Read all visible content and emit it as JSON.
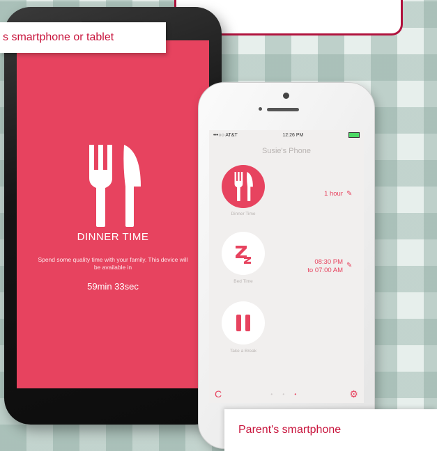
{
  "labels": {
    "device": "s smartphone or tablet",
    "parent": "Parent's smartphone"
  },
  "android": {
    "title": "DINNER TIME",
    "message": "Spend some quality time with your family. This device will be available in",
    "countdown": "59min 33sec",
    "icon": "fork-knife-icon"
  },
  "iphone": {
    "status": {
      "carrier": "•••○○ AT&T",
      "time": "12:26 PM"
    },
    "title": "Susie's Phone",
    "rows": [
      {
        "icon": "fork-knife-icon",
        "label": "Dinner Time",
        "value": "1 hour"
      },
      {
        "icon": "sleep-zz-icon",
        "label": "Bed Time",
        "value_line1": "08:30 PM",
        "value_line2": "to 07:00 AM"
      },
      {
        "icon": "pause-icon",
        "label": "Take a Break",
        "value": ""
      }
    ],
    "bottom": {
      "refresh_icon": "refresh-icon",
      "settings_icon": "gear-icon"
    }
  },
  "colors": {
    "accent": "#e7435f",
    "label_text": "#c8143c",
    "frame": "#b0123d"
  }
}
